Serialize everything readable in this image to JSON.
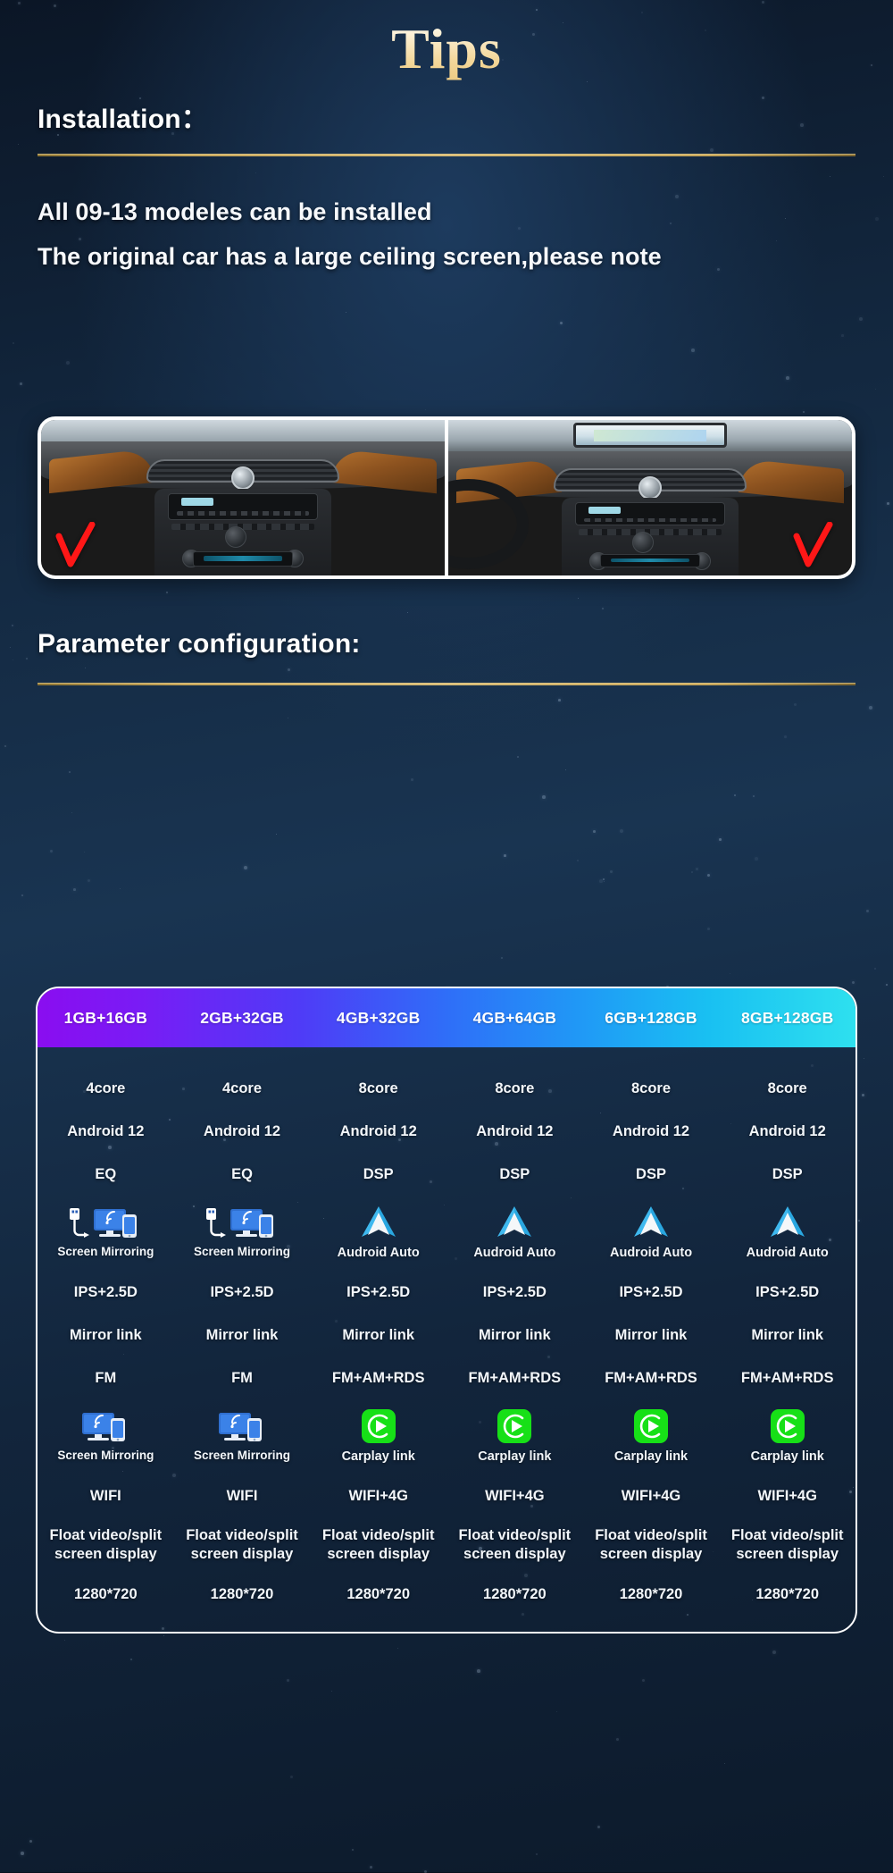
{
  "page": {
    "title": "Tips",
    "background_color": "#12263d",
    "accent_gold": "#d9bd78"
  },
  "installation": {
    "heading": "Installation：",
    "lines": [
      "All 09-13 modeles can be installed",
      "The original car has a large ceiling screen,please note"
    ],
    "photos": [
      {
        "name": "dashboard-without-ceiling-screen",
        "badge": "check"
      },
      {
        "name": "dashboard-with-ceiling-screen",
        "badge": "check"
      }
    ]
  },
  "parameter_configuration": {
    "heading": "Parameter configuration:",
    "columns": [
      "1GB+16GB",
      "2GB+32GB",
      "4GB+32GB",
      "4GB+64GB",
      "6GB+128GB",
      "8GB+128GB"
    ],
    "rows": [
      {
        "type": "text",
        "values": [
          "4core",
          "4core",
          "8core",
          "8core",
          "8core",
          "8core"
        ]
      },
      {
        "type": "text",
        "values": [
          "Android 12",
          "Android 12",
          "Android 12",
          "Android 12",
          "Android 12",
          "Android 12"
        ]
      },
      {
        "type": "text",
        "values": [
          "EQ",
          "EQ",
          "DSP",
          "DSP",
          "DSP",
          "DSP"
        ]
      },
      {
        "type": "icon",
        "icons": [
          "usb-screen-mirroring-icon",
          "usb-screen-mirroring-icon",
          "android-auto-icon",
          "android-auto-icon",
          "android-auto-icon",
          "android-auto-icon"
        ],
        "values": [
          "Screen Mirroring",
          "Screen Mirroring",
          "Audroid Auto",
          "Audroid Auto",
          "Audroid Auto",
          "Audroid Auto"
        ]
      },
      {
        "type": "text",
        "values": [
          "IPS+2.5D",
          "IPS+2.5D",
          "IPS+2.5D",
          "IPS+2.5D",
          "IPS+2.5D",
          "IPS+2.5D"
        ]
      },
      {
        "type": "text",
        "values": [
          "Mirror link",
          "Mirror link",
          "Mirror link",
          "Mirror link",
          "Mirror link",
          "Mirror link"
        ]
      },
      {
        "type": "text",
        "values": [
          "FM",
          "FM",
          "FM+AM+RDS",
          "FM+AM+RDS",
          "FM+AM+RDS",
          "FM+AM+RDS"
        ]
      },
      {
        "type": "icon",
        "icons": [
          "screen-mirroring-icon",
          "screen-mirroring-icon",
          "carplay-icon",
          "carplay-icon",
          "carplay-icon",
          "carplay-icon"
        ],
        "values": [
          "Screen Mirroring",
          "Screen Mirroring",
          "Carplay link",
          "Carplay link",
          "Carplay link",
          "Carplay link"
        ]
      },
      {
        "type": "text",
        "values": [
          "WIFI",
          "WIFI",
          "WIFI+4G",
          "WIFI+4G",
          "WIFI+4G",
          "WIFI+4G"
        ]
      },
      {
        "type": "two",
        "values": [
          "Float video/split screen display",
          "Float video/split screen display",
          "Float video/split screen display",
          "Float video/split screen display",
          "Float video/split screen display",
          "Float video/split screen display"
        ]
      },
      {
        "type": "text",
        "values": [
          "1280*720",
          "1280*720",
          "1280*720",
          "1280*720",
          "1280*720",
          "1280*720"
        ]
      }
    ]
  }
}
